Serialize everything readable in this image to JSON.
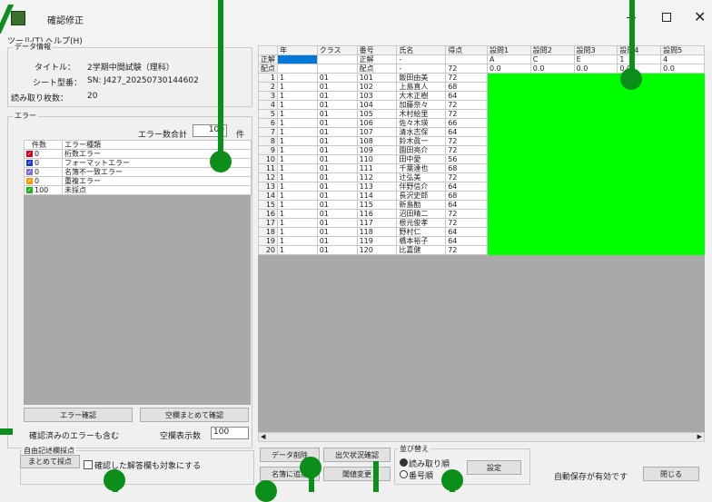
{
  "window": {
    "title": "確認修正"
  },
  "menu": [
    "ツール(T)",
    "ヘルプ(H)"
  ],
  "data_info": {
    "group_label": "データ情報",
    "title_label": "タイトル：",
    "title_value": "2学期中間試験（理科）",
    "model_label": "シート型番：",
    "model_value": "SN: J427_20250730144602",
    "count_label": "読み取り枚数：",
    "count_value": "20"
  },
  "error": {
    "group_label": "エラー",
    "total_label": "エラー数合計",
    "total_value": "100",
    "total_unit": "件",
    "headers": [
      "件数",
      "エラー種類"
    ],
    "rows": [
      {
        "count": "0",
        "type": "桁数エラー",
        "color": "#e0001b"
      },
      {
        "count": "0",
        "type": "フォーマットエラー",
        "color": "#1b39d6"
      },
      {
        "count": "0",
        "type": "名簿不一致エラー",
        "color": "#8a6bd6"
      },
      {
        "count": "0",
        "type": "重複エラー",
        "color": "#ff9a00"
      },
      {
        "count": "100",
        "type": "未採点",
        "color": "#19b41b"
      }
    ],
    "confirm_button": "エラー確認",
    "blank_button": "空欄まとめて確認",
    "include_label": "確認済みのエラーも含む",
    "blank_count_label": "空欄表示数",
    "blank_count_value": "100"
  },
  "free": {
    "group_label": "自由記述欄採点",
    "bulk_button": "まとめて採点",
    "checkbox_label": "確認した解答欄も対象にする"
  },
  "grid": {
    "headers": [
      "",
      "年",
      "クラス",
      "番号",
      "氏名",
      "得点",
      "設問1",
      "設問2",
      "設問3",
      "設問4",
      "設問5"
    ],
    "answer_row": {
      "label": "正解",
      "num": "正解",
      "name": "-",
      "answers": [
        "A",
        "C",
        "E",
        "1",
        "4"
      ]
    },
    "score_row": {
      "label": "配点",
      "num": "配点",
      "name": "-",
      "score": "72",
      "values": [
        "0.0",
        "0.0",
        "0.0",
        "0.0",
        "0.0"
      ]
    },
    "rows": [
      {
        "idx": "1",
        "year": "1",
        "cls": "01",
        "num": "101",
        "name": "飯田由美",
        "score": "72"
      },
      {
        "idx": "2",
        "year": "1",
        "cls": "01",
        "num": "102",
        "name": "上島直人",
        "score": "68"
      },
      {
        "idx": "3",
        "year": "1",
        "cls": "01",
        "num": "103",
        "name": "大木正樹",
        "score": "64"
      },
      {
        "idx": "4",
        "year": "1",
        "cls": "01",
        "num": "104",
        "name": "加藤奈々",
        "score": "72"
      },
      {
        "idx": "5",
        "year": "1",
        "cls": "01",
        "num": "105",
        "name": "木村絵里",
        "score": "72"
      },
      {
        "idx": "6",
        "year": "1",
        "cls": "01",
        "num": "106",
        "name": "佐々木瑛",
        "score": "66"
      },
      {
        "idx": "7",
        "year": "1",
        "cls": "01",
        "num": "107",
        "name": "清水志保",
        "score": "64"
      },
      {
        "idx": "8",
        "year": "1",
        "cls": "01",
        "num": "108",
        "name": "鈴木眞一",
        "score": "72"
      },
      {
        "idx": "9",
        "year": "1",
        "cls": "01",
        "num": "109",
        "name": "園田亮介",
        "score": "72"
      },
      {
        "idx": "10",
        "year": "1",
        "cls": "01",
        "num": "110",
        "name": "田中愛",
        "score": "56"
      },
      {
        "idx": "11",
        "year": "1",
        "cls": "01",
        "num": "111",
        "name": "千葉達也",
        "score": "68"
      },
      {
        "idx": "12",
        "year": "1",
        "cls": "01",
        "num": "112",
        "name": "辻弘美",
        "score": "72"
      },
      {
        "idx": "13",
        "year": "1",
        "cls": "01",
        "num": "113",
        "name": "伴野信介",
        "score": "64"
      },
      {
        "idx": "14",
        "year": "1",
        "cls": "01",
        "num": "114",
        "name": "長沢史郎",
        "score": "68"
      },
      {
        "idx": "15",
        "year": "1",
        "cls": "01",
        "num": "115",
        "name": "新島勧",
        "score": "64"
      },
      {
        "idx": "16",
        "year": "1",
        "cls": "01",
        "num": "116",
        "name": "沼田晴二",
        "score": "72"
      },
      {
        "idx": "17",
        "year": "1",
        "cls": "01",
        "num": "117",
        "name": "根元俊孝",
        "score": "72"
      },
      {
        "idx": "18",
        "year": "1",
        "cls": "01",
        "num": "118",
        "name": "野村仁",
        "score": "64"
      },
      {
        "idx": "19",
        "year": "1",
        "cls": "01",
        "num": "119",
        "name": "橋本裕子",
        "score": "64"
      },
      {
        "idx": "20",
        "year": "1",
        "cls": "01",
        "num": "120",
        "name": "比嘉健",
        "score": "72"
      }
    ]
  },
  "bottom": {
    "delete_button": "データ削除",
    "attendance_button": "出欠状況確認",
    "roster_button": "名簿に追加",
    "pass_button": "閾値変更",
    "sort_label": "並び替え",
    "sort_options": [
      "読み取り順",
      "番号順"
    ],
    "settings_button": "設定",
    "autosave_text": "自動保存が有効です",
    "close_button": "閉じる"
  },
  "colors": {
    "fill": "#00ff00",
    "accent": "#0c8f1a",
    "selected": "#0078d7"
  },
  "icons": {
    "app": "app-icon",
    "minimize": "minimize-icon",
    "maximize": "maximize-icon",
    "close": "close-icon"
  }
}
